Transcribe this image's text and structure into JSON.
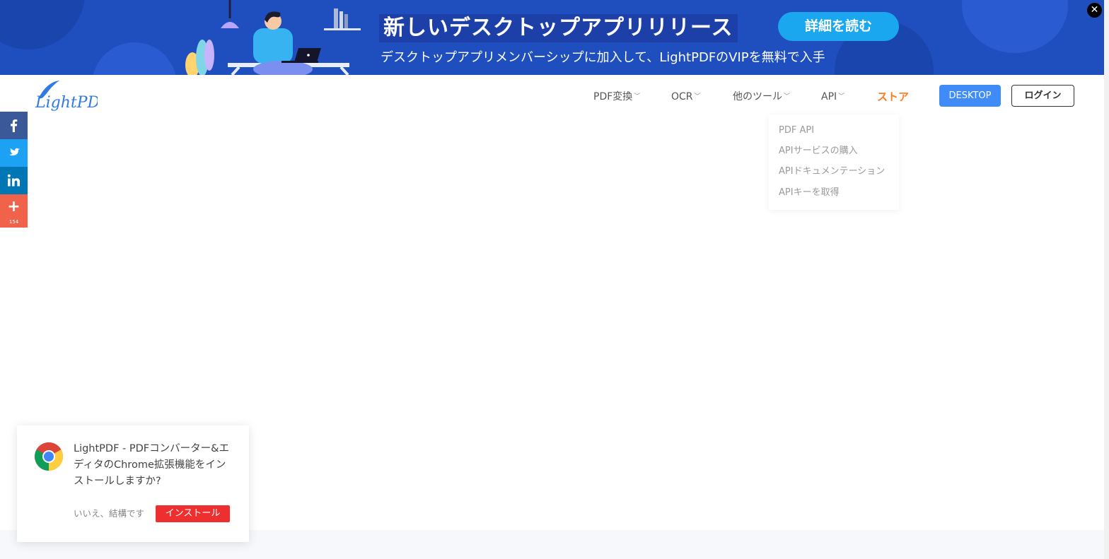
{
  "banner": {
    "title": "新しいデスクトップアプリリリース",
    "subtitle": "デスクトップアプリメンバーシップに加入して、LightPDFのVIPを無料で入手",
    "cta": "詳細を読む",
    "close": "✕",
    "background_color": "#1f4fbf",
    "cta_color": "#1aa7f0"
  },
  "header": {
    "logo_text": "LightPDF",
    "nav": [
      {
        "label": "PDF変換"
      },
      {
        "label": "OCR"
      },
      {
        "label": "他のツール"
      },
      {
        "label": "API"
      },
      {
        "label": "ストア"
      }
    ],
    "chevron": "﹀",
    "desktop_button": "DESKTOP",
    "login_button": "ログイン",
    "accent_color": "#ff7a1a",
    "desktop_color": "#3f8bf7"
  },
  "api_dropdown": {
    "items": [
      "PDF API",
      "APIサービスの購入",
      "APIドキュメンテーション",
      "APIキーを取得"
    ]
  },
  "social": {
    "items": [
      {
        "name": "facebook",
        "icon": "facebook-icon",
        "color": "#3b5998"
      },
      {
        "name": "twitter",
        "icon": "twitter-icon",
        "color": "#1da1f2"
      },
      {
        "name": "linkedin",
        "icon": "linkedin-icon",
        "color": "#0077b5"
      },
      {
        "name": "more",
        "icon": "plus-icon",
        "color": "#f0624a"
      }
    ],
    "more_symbol": "+",
    "share_count": "154"
  },
  "extension_popup": {
    "message": "LightPDF - PDFコンバーター&エディタのChrome拡張機能をインストールしますか?",
    "decline": "いいえ、結構です",
    "install": "インストール",
    "install_color": "#ee2f2f"
  }
}
